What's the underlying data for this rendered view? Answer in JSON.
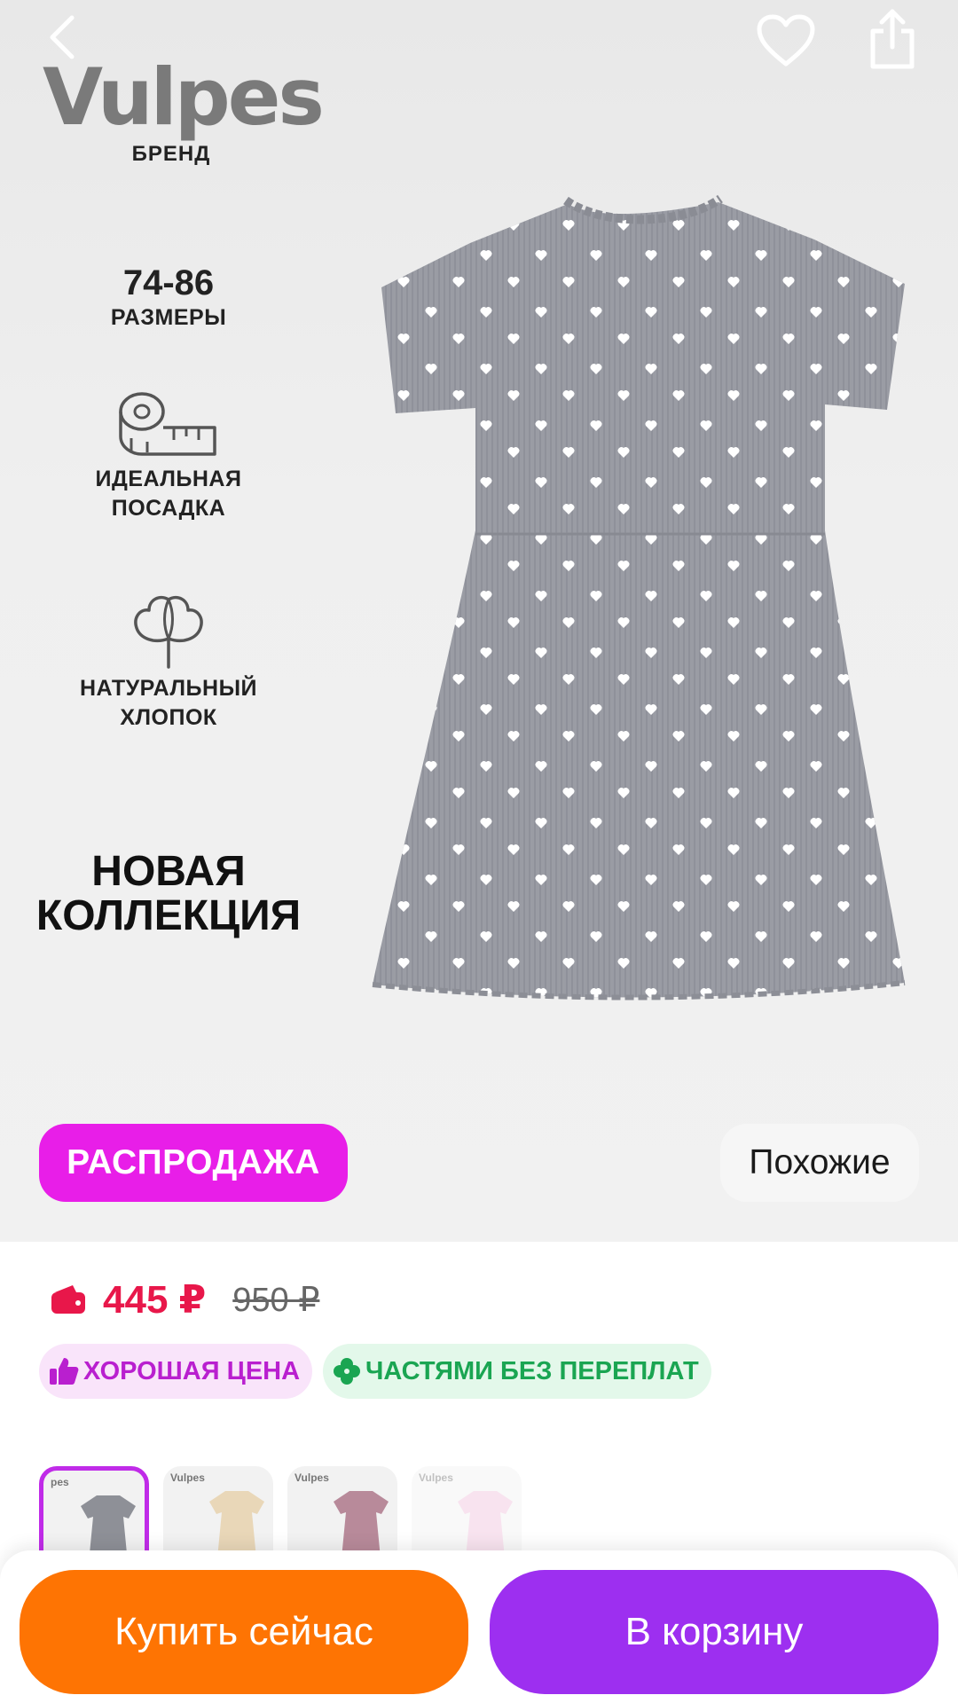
{
  "brand": {
    "logo": "Vulpes",
    "subtitle": "БРЕНД"
  },
  "features": [
    {
      "number": "74-86",
      "text": "РАЗМЕРЫ",
      "icon": "size-text"
    },
    {
      "number": "",
      "text": "ИДЕАЛЬНАЯ\nПОСАДКА",
      "icon": "measuring-tape-icon"
    },
    {
      "number": "",
      "text": "НАТУРАЛЬНЫЙ\nХЛОПОК",
      "icon": "cotton-icon"
    }
  ],
  "promo": {
    "headline": "НОВАЯ\nКОЛЛЕКЦИЯ"
  },
  "header": {
    "back_icon": "chevron-left-icon",
    "favorite_icon": "heart-icon",
    "share_icon": "share-icon"
  },
  "badges": {
    "sale": "РАСПРОДАЖА",
    "similar": "Похожие"
  },
  "price": {
    "current": "445 ₽",
    "old": "950 ₽",
    "icon": "wallet-icon"
  },
  "chips": {
    "good_price": "ХОРОШАЯ ЦЕНА",
    "installments": "ЧАСТЯМИ БЕЗ ПЕРЕПЛАТ"
  },
  "thumbnails": [
    {
      "logo": "pes",
      "color": "#8e9097"
    },
    {
      "logo": "Vulpes",
      "color": "#e9d7b8"
    },
    {
      "logo": "Vulpes",
      "color": "#b88a9a"
    },
    {
      "logo": "Vulpes",
      "color": "#f0c2dc"
    }
  ],
  "actions": {
    "buy_now": "Купить сейчас",
    "add_to_cart": "В корзину"
  },
  "colors": {
    "sale": "#e81ee8",
    "price": "#e8174a",
    "buy": "#fe7403",
    "cart": "#9d2ff0",
    "good_price": "#b91fcf",
    "installments": "#1aa552"
  }
}
